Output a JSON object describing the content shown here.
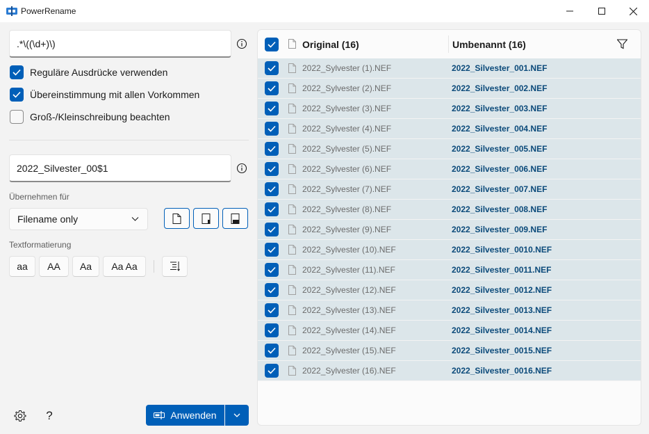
{
  "window": {
    "title": "PowerRename"
  },
  "search": {
    "value": ".*\\((\\d+)\\)"
  },
  "options": [
    {
      "label": "Reguläre Ausdrücke verwenden",
      "checked": true
    },
    {
      "label": "Übereinstimmung mit allen Vorkommen",
      "checked": true
    },
    {
      "label": "Groß-/Kleinschreibung beachten",
      "checked": false
    }
  ],
  "replace": {
    "value": "2022_Silvester_00$1"
  },
  "apply_for": {
    "label": "Übernehmen für",
    "selected": "Filename only"
  },
  "text_format": {
    "label": "Textformatierung",
    "buttons": [
      "aa",
      "AA",
      "Aa",
      "Aa Aa"
    ]
  },
  "apply_button": {
    "label": "Anwenden"
  },
  "list": {
    "header_original": "Original (16)",
    "header_renamed": "Umbenannt (16)",
    "rows": [
      {
        "original": "2022_Sylvester (1).NEF",
        "renamed": "2022_Silvester_001.NEF"
      },
      {
        "original": "2022_Sylvester (2).NEF",
        "renamed": "2022_Silvester_002.NEF"
      },
      {
        "original": "2022_Sylvester (3).NEF",
        "renamed": "2022_Silvester_003.NEF"
      },
      {
        "original": "2022_Sylvester (4).NEF",
        "renamed": "2022_Silvester_004.NEF"
      },
      {
        "original": "2022_Sylvester (5).NEF",
        "renamed": "2022_Silvester_005.NEF"
      },
      {
        "original": "2022_Sylvester (6).NEF",
        "renamed": "2022_Silvester_006.NEF"
      },
      {
        "original": "2022_Sylvester (7).NEF",
        "renamed": "2022_Silvester_007.NEF"
      },
      {
        "original": "2022_Sylvester (8).NEF",
        "renamed": "2022_Silvester_008.NEF"
      },
      {
        "original": "2022_Sylvester (9).NEF",
        "renamed": "2022_Silvester_009.NEF"
      },
      {
        "original": "2022_Sylvester (10).NEF",
        "renamed": "2022_Silvester_0010.NEF"
      },
      {
        "original": "2022_Sylvester (11).NEF",
        "renamed": "2022_Silvester_0011.NEF"
      },
      {
        "original": "2022_Sylvester (12).NEF",
        "renamed": "2022_Silvester_0012.NEF"
      },
      {
        "original": "2022_Sylvester (13).NEF",
        "renamed": "2022_Silvester_0013.NEF"
      },
      {
        "original": "2022_Sylvester (14).NEF",
        "renamed": "2022_Silvester_0014.NEF"
      },
      {
        "original": "2022_Sylvester (15).NEF",
        "renamed": "2022_Silvester_0015.NEF"
      },
      {
        "original": "2022_Sylvester (16).NEF",
        "renamed": "2022_Silvester_0016.NEF"
      }
    ]
  },
  "colors": {
    "accent": "#005fb8",
    "row_bg": "#dce6ea",
    "renamed_text": "#0b4a7a"
  },
  "icons": [
    "app-icon",
    "minimize-icon",
    "maximize-icon",
    "close-icon",
    "info-icon",
    "chevron-down-icon",
    "file-icon",
    "folder-icon",
    "settings-icon",
    "help-icon",
    "filter-icon",
    "enumerate-icon",
    "rename-icon"
  ]
}
